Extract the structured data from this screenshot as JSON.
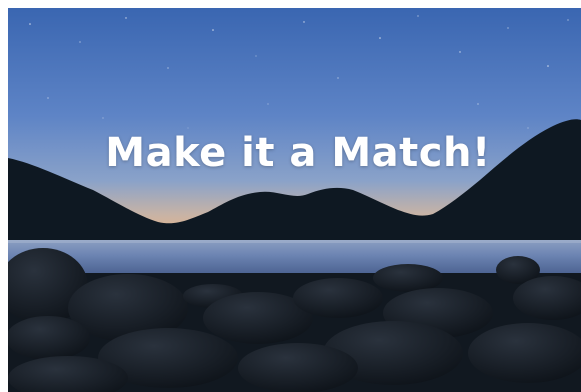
{
  "hero": {
    "headline": "Make it a Match!",
    "background_image": "night-lake-mountains-stars-image"
  },
  "colors": {
    "sky_top": "#3f6bb5",
    "sky_mid": "#5f85c7",
    "horizon_glow": "#e0b28c",
    "mountains": "#0e1822",
    "lake": "#6d86b3",
    "rocks": "#141b24",
    "headline_text": "#ffffff"
  }
}
